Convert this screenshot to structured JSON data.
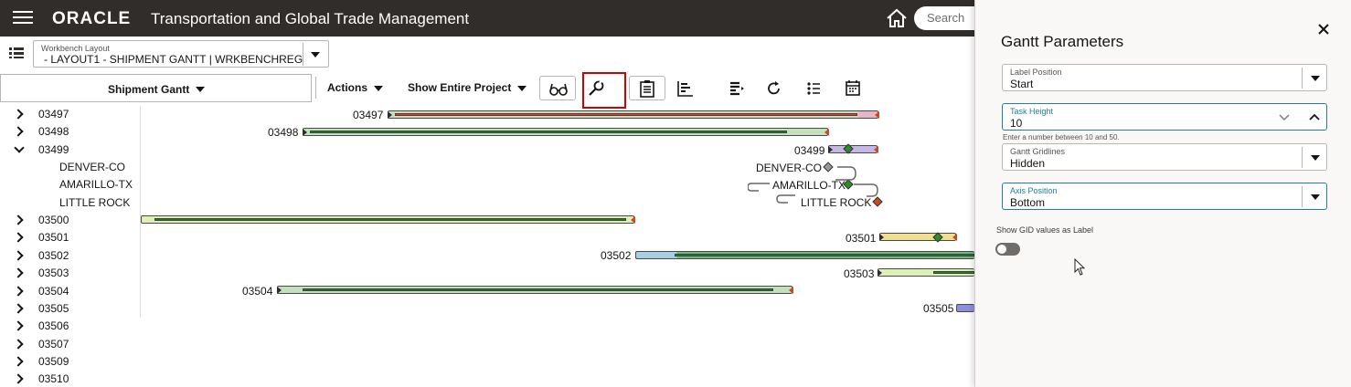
{
  "header": {
    "logo": "ORACLE",
    "title": "Transportation and Global Trade Management",
    "search_placeholder": "Search"
  },
  "workbench": {
    "label": "Workbench Layout",
    "value": "- LAYOUT1 - SHIPMENT GANTT | WRKBENCHREG"
  },
  "toolbar": {
    "gantt_select": "Shipment Gantt",
    "actions": "Actions",
    "show_project": "Show Entire Project",
    "icons": [
      "glasses-icon",
      "wrench-icon",
      "clipboard-icon",
      "gantt-chart-icon",
      "align-icon",
      "refresh-icon",
      "list-settings-icon",
      "calendar-icon"
    ]
  },
  "gantt": {
    "rows": [
      {
        "label": "03497",
        "expand": "collapsed"
      },
      {
        "label": "03498",
        "expand": "collapsed"
      },
      {
        "label": "03499",
        "expand": "expanded"
      },
      {
        "label": "DENVER-CO",
        "expand": "none"
      },
      {
        "label": "AMARILLO-TX",
        "expand": "none"
      },
      {
        "label": "LITTLE ROCK",
        "expand": "none"
      },
      {
        "label": "03500",
        "expand": "collapsed"
      },
      {
        "label": "03501",
        "expand": "collapsed"
      },
      {
        "label": "03502",
        "expand": "collapsed"
      },
      {
        "label": "03503",
        "expand": "collapsed"
      },
      {
        "label": "03504",
        "expand": "collapsed"
      },
      {
        "label": "03505",
        "expand": "collapsed"
      },
      {
        "label": "03506",
        "expand": "collapsed"
      },
      {
        "label": "03507",
        "expand": "collapsed"
      },
      {
        "label": "03509",
        "expand": "collapsed"
      },
      {
        "label": "03510",
        "expand": "collapsed"
      }
    ],
    "bar_labels": {
      "b03497": "03497",
      "b03498": "03498",
      "b03499": "03499",
      "denver": "DENVER-CO",
      "amarillo": "AMARILLO-TX",
      "littlerock": "LITTLE ROCK",
      "b03501": "03501",
      "b03502": "03502",
      "b03503": "03503",
      "b03504": "03504",
      "b03505": "03505"
    }
  },
  "drawer": {
    "title": "Gantt Parameters",
    "label_position": {
      "label": "Label Position",
      "value": "Start"
    },
    "task_height": {
      "label": "Task Height",
      "value": "10",
      "hint": "Enter a number between 10 and 50."
    },
    "gridlines": {
      "label": "Gantt Gridlines",
      "value": "Hidden"
    },
    "axis_position": {
      "label": "Axis Position",
      "value": "Bottom"
    },
    "gid_toggle": {
      "label": "Show GID values as Label",
      "on": false
    }
  }
}
